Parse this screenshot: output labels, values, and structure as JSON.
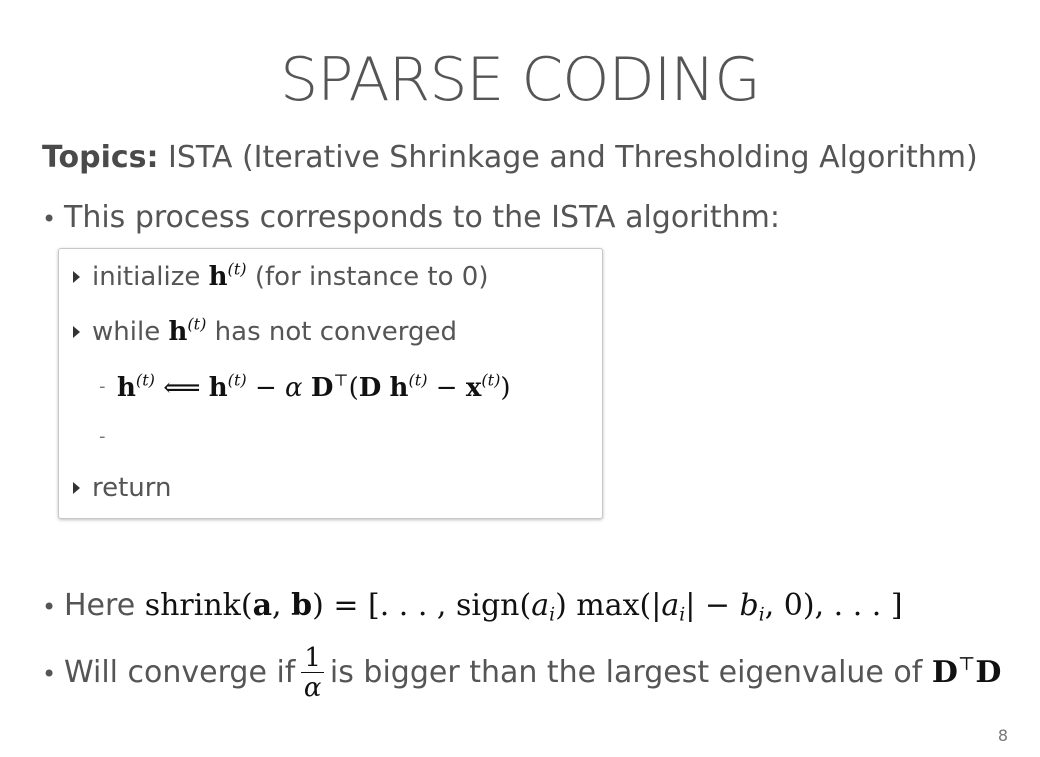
{
  "slide": {
    "title": "SPARSE CODING",
    "topics_label": "Topics:",
    "topics_text": "ISTA (Iterative Shrinkage and Thresholding Algorithm)",
    "page_number": "8"
  },
  "bullets": {
    "b1_text": "This process corresponds to the ISTA algorithm:",
    "b2_prefix": "Here",
    "b3_prefix": "Will converge if",
    "b3_middle": "is bigger than the largest eigenvalue of"
  },
  "algorithm": {
    "line1_prefix": "initialize",
    "line1_suffix": "(for instance to 0)",
    "line2_prefix": "while",
    "line2_suffix": "has not converged",
    "line5_text": "return"
  }
}
